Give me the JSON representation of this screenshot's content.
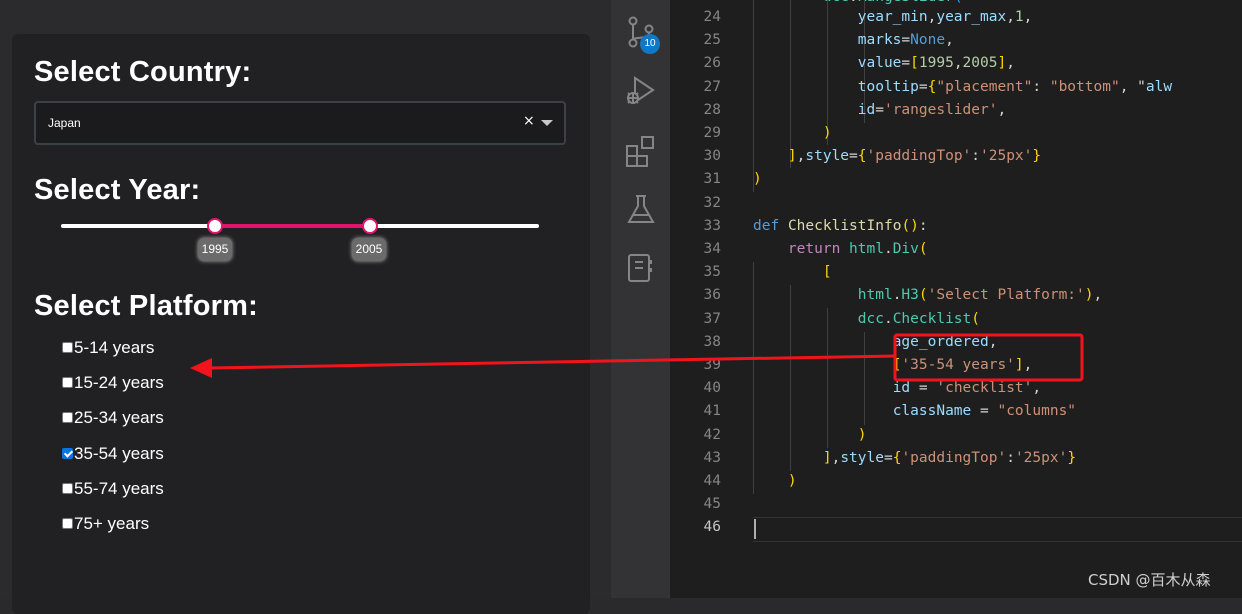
{
  "app": {
    "country_heading": "Select Country:",
    "country_value": "Japan",
    "clear_symbol": "×",
    "year_heading": "Select Year:",
    "slider": {
      "low_label": "1995",
      "high_label": "2005",
      "low_value": 1995,
      "high_value": 2005,
      "accent": "#e0166d"
    },
    "platform_heading": "Select Platform:",
    "checklist": [
      {
        "label": "5-14 years",
        "checked": false
      },
      {
        "label": "15-24 years",
        "checked": false
      },
      {
        "label": "25-34 years",
        "checked": false
      },
      {
        "label": "35-54 years",
        "checked": true
      },
      {
        "label": "55-74 years",
        "checked": false
      },
      {
        "label": "75+ years",
        "checked": false
      }
    ]
  },
  "activity_bar": {
    "badge": "10",
    "icons": [
      "source-control-icon",
      "run-debug-icon",
      "extensions-icon",
      "testing-icon",
      "notebook-icon"
    ]
  },
  "editor": {
    "lines": [
      {
        "n": "24",
        "text": "            year_min,year_max,1,"
      },
      {
        "n": "25",
        "text": "            marks=None,"
      },
      {
        "n": "26",
        "text": "            value=[1995,2005],"
      },
      {
        "n": "27",
        "text": "            tooltip={\"placement\": \"bottom\", \"alw"
      },
      {
        "n": "28",
        "text": "            id='rangeslider',"
      },
      {
        "n": "29",
        "text": "        )"
      },
      {
        "n": "30",
        "text": "    ],style={'paddingTop':'25px'}"
      },
      {
        "n": "31",
        "text": ")"
      },
      {
        "n": "32",
        "text": ""
      },
      {
        "n": "33",
        "text": "def ChecklistInfo():"
      },
      {
        "n": "34",
        "text": "    return html.Div("
      },
      {
        "n": "35",
        "text": "        ["
      },
      {
        "n": "36",
        "text": "            html.H3('Select Platform:'),"
      },
      {
        "n": "37",
        "text": "            dcc.Checklist("
      },
      {
        "n": "38",
        "text": "                age_ordered,"
      },
      {
        "n": "39",
        "text": "                ['35-54 years'],"
      },
      {
        "n": "40",
        "text": "                id = 'checklist',"
      },
      {
        "n": "41",
        "text": "                className = \"columns\""
      },
      {
        "n": "42",
        "text": "            )"
      },
      {
        "n": "43",
        "text": "        ],style={'paddingTop':'25px'}"
      },
      {
        "n": "44",
        "text": "    )"
      },
      {
        "n": "45",
        "text": ""
      },
      {
        "n": "46",
        "text": ""
      }
    ],
    "top_partial": "    dcc.RangeSlider("
  },
  "watermark": "CSDN @百木从森",
  "colors": {
    "annotation_red": "#f2141d",
    "badge_blue": "#0e78c9"
  }
}
